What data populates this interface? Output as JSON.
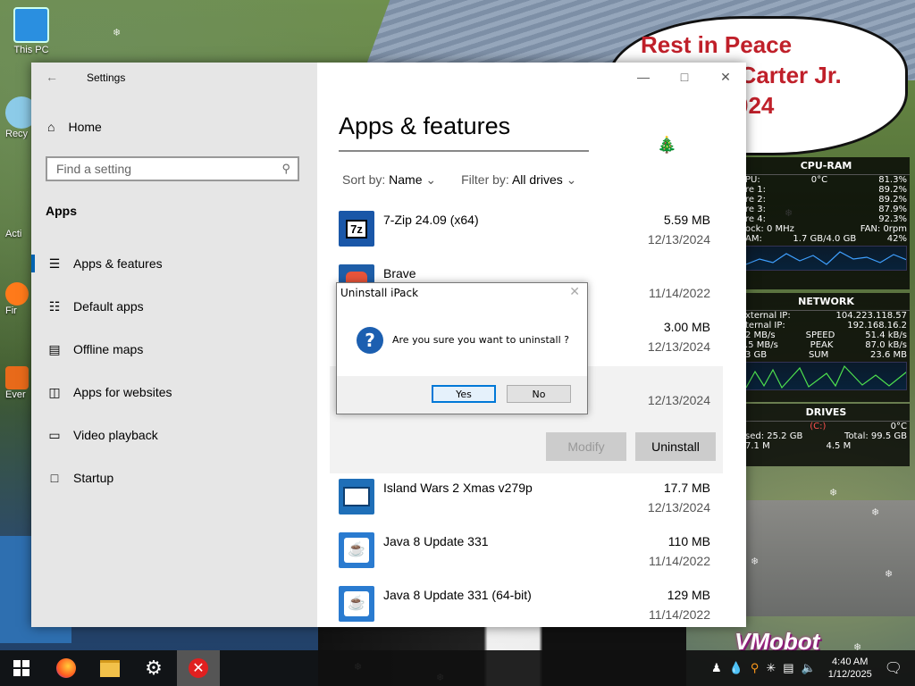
{
  "desktop": {
    "icons": [
      {
        "label": "This PC"
      },
      {
        "label": "Recy"
      },
      {
        "label": "Acti"
      },
      {
        "label": "Fir"
      },
      {
        "label": "Ever"
      }
    ],
    "memorial": {
      "line1": "Rest in Peace",
      "line2": "rl Carter Jr.",
      "line3": "024"
    },
    "watermark": "VMobot"
  },
  "gadgets": {
    "cpu_ram": {
      "title": "CPU-RAM",
      "rows": [
        {
          "left": "PU:",
          "mid": "0°C",
          "right": "81.3%"
        },
        {
          "left": "re 1:",
          "mid": "",
          "right": "89.2%"
        },
        {
          "left": "re 2:",
          "mid": "",
          "right": "89.2%"
        },
        {
          "left": "re 3:",
          "mid": "",
          "right": "87.9%"
        },
        {
          "left": "re 4:",
          "mid": "",
          "right": "92.3%"
        },
        {
          "left": "ock: 0 MHz",
          "mid": "",
          "right": "FAN: 0rpm"
        },
        {
          "left": "AM:",
          "mid": "1.7 GB/4.0 GB",
          "right": "42%"
        }
      ]
    },
    "network": {
      "title": "NETWORK",
      "rows": [
        {
          "left": "xternal IP:",
          "right": "104.223.118.57"
        },
        {
          "left": "ternal IP:",
          "right": "192.168.16.2"
        },
        {
          "left": "2 MB/s",
          "mid": "SPEED",
          "right": "51.4 kB/s"
        },
        {
          "left": ".5 MB/s",
          "mid": "PEAK",
          "right": "87.0 kB/s"
        },
        {
          "left": "3 GB",
          "mid": "SUM",
          "right": "23.6 MB"
        }
      ]
    },
    "drives": {
      "title": "DRIVES",
      "rows": [
        {
          "left": "",
          "mid": "(C:)",
          "right": "0°C"
        },
        {
          "left": "sed: 25.2 GB",
          "right": "Total: 99.5 GB"
        },
        {
          "left": "7.1 M",
          "mid": "4.5 M",
          "right": ""
        }
      ]
    }
  },
  "settings": {
    "window_title": "Settings",
    "home_label": "Home",
    "search_placeholder": "Find a setting",
    "section_label": "Apps",
    "nav": [
      {
        "label": "Apps & features",
        "icon": "list-icon",
        "selected": true
      },
      {
        "label": "Default apps",
        "icon": "default-apps-icon"
      },
      {
        "label": "Offline maps",
        "icon": "map-icon"
      },
      {
        "label": "Apps for websites",
        "icon": "web-apps-icon"
      },
      {
        "label": "Video playback",
        "icon": "video-icon"
      },
      {
        "label": "Startup",
        "icon": "startup-icon"
      }
    ],
    "page_title": "Apps & features",
    "sort_label": "Sort by:",
    "sort_value": "Name",
    "filter_label": "Filter by:",
    "filter_value": "All drives",
    "apps": [
      {
        "name": "7-Zip 24.09 (x64)",
        "size": "5.59 MB",
        "date": "12/13/2024",
        "icon": "7zip-icon",
        "color": "#1a1a1a"
      },
      {
        "name": "Brave",
        "size": "",
        "date": "11/14/2022",
        "icon": "brave-icon",
        "color": "#e8543a"
      },
      {
        "name": "",
        "size": "3.00 MB",
        "date": "12/13/2024",
        "icon": "app-icon",
        "color": "#d0d0d0"
      },
      {
        "name": "",
        "size": "",
        "date": "12/13/2024",
        "icon": "app-icon",
        "color": "#d0d0d0"
      },
      {
        "name": "Island Wars 2 Xmas v279p",
        "size": "17.7 MB",
        "date": "12/13/2024",
        "icon": "island-wars-icon",
        "color": "#1f6fb8"
      },
      {
        "name": "Java 8 Update 331",
        "size": "110 MB",
        "date": "11/14/2022",
        "icon": "java-icon",
        "color": "#2a7bd0"
      },
      {
        "name": "Java 8 Update 331 (64-bit)",
        "size": "129 MB",
        "date": "11/14/2022",
        "icon": "java-icon",
        "color": "#2a7bd0"
      }
    ],
    "modify_label": "Modify",
    "uninstall_label": "Uninstall"
  },
  "dialog": {
    "title": "Uninstall iPack",
    "message": "Are you sure you want to uninstall ?",
    "yes_label": "Yes",
    "no_label": "No"
  },
  "taskbar": {
    "time": "4:40 AM",
    "date": "1/12/2025"
  },
  "colors": {
    "accent": "#0063b1",
    "dialog_icon": "#1c5fb0",
    "memorial_text": "#c0202a"
  }
}
